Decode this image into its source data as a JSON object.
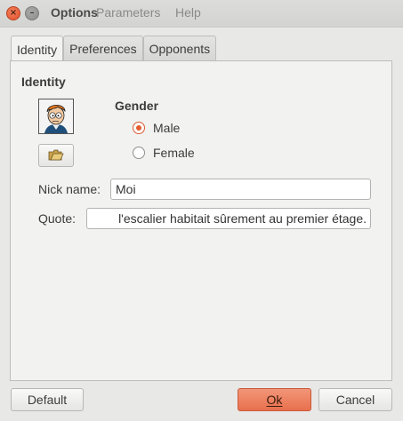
{
  "window": {
    "title": "Options",
    "menu": [
      "Parameters",
      "Help"
    ],
    "close_glyph": "×",
    "minimize_glyph": "–"
  },
  "tabs": [
    {
      "label": "Identity",
      "active": true
    },
    {
      "label": "Preferences",
      "active": false
    },
    {
      "label": "Opponents",
      "active": false
    }
  ],
  "identity": {
    "section_title": "Identity",
    "avatar_icon": "character-avatar",
    "change_avatar_icon": "open-folder-icon"
  },
  "gender": {
    "title": "Gender",
    "options": [
      {
        "label": "Male",
        "selected": true
      },
      {
        "label": "Female",
        "selected": false
      }
    ]
  },
  "fields": {
    "nick_label": "Nick name:",
    "nick_value": "Moi",
    "quote_label": "Quote:",
    "quote_value": "l'escalier habitait sûrement au premier étage."
  },
  "buttons": {
    "default": "Default",
    "ok": "Ok",
    "cancel": "Cancel"
  },
  "colors": {
    "accent": "#e8704d",
    "radio_selected": "#e35c2f",
    "close_button": "#e2512b"
  }
}
